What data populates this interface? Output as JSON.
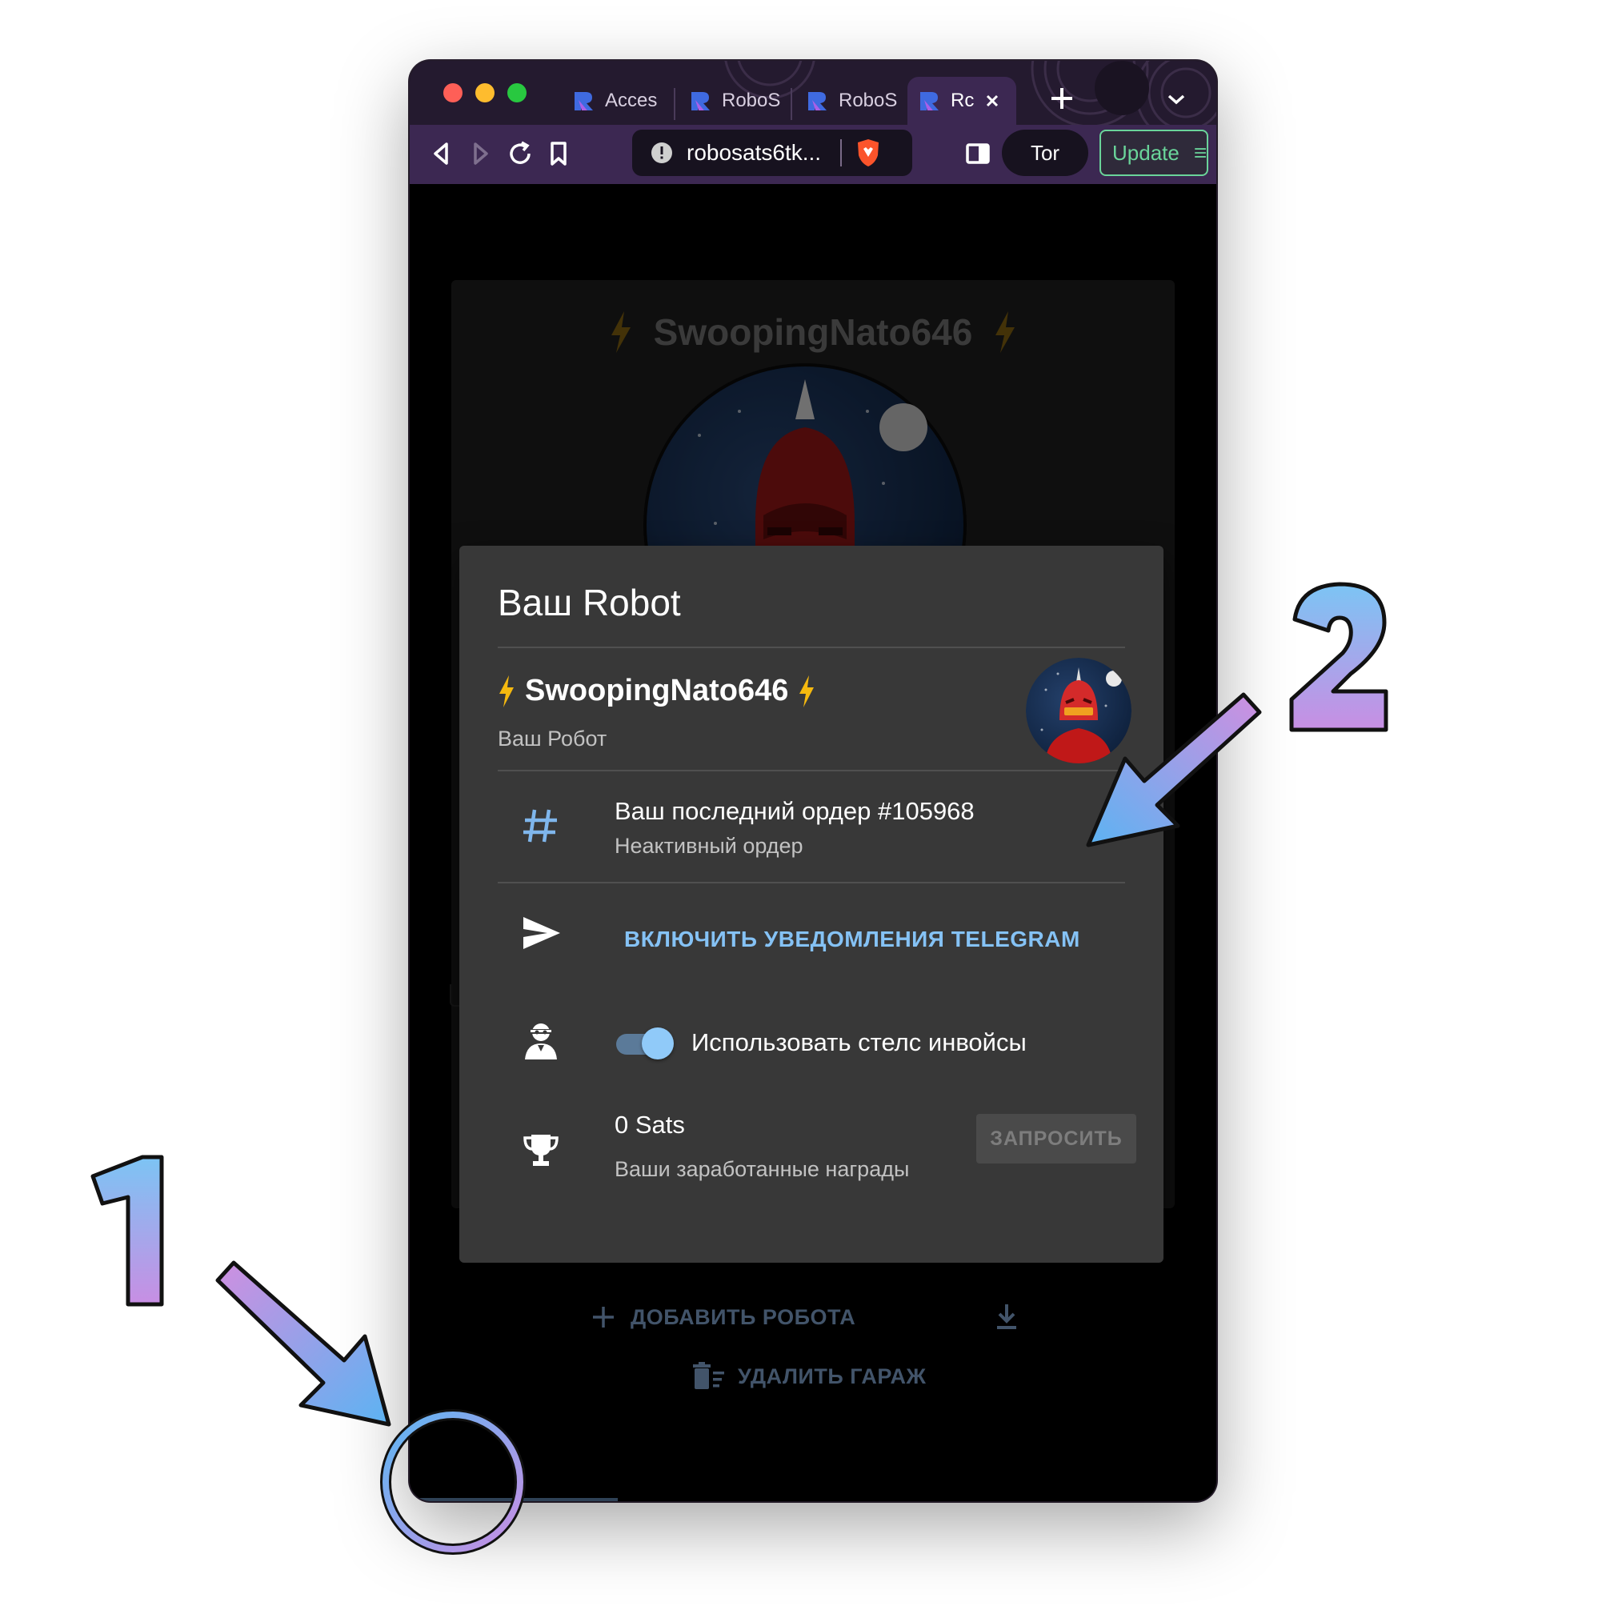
{
  "browser": {
    "tabs": [
      {
        "label": "Acces"
      },
      {
        "label": "RoboS"
      },
      {
        "label": "RoboS"
      },
      {
        "label": "Rc",
        "active": true
      }
    ],
    "url": "robosats6tk...",
    "tor_label": "Tor",
    "update_label": "Update"
  },
  "garage": {
    "robot_name": "SwoopingNato646",
    "add_robot_label": "ДОБАВИТЬ РОБОТА",
    "delete_garage_label": "УДАЛИТЬ ГАРАЖ"
  },
  "modal": {
    "title": "Ваш Robot",
    "nickname": "SwoopingNato646",
    "nickname_sub": "Ваш Робот",
    "last_order": {
      "primary": "Ваш последний ордер #105968",
      "secondary": "Неактивный ордер"
    },
    "telegram_label": "ВКЛЮЧИТЬ УВЕДОМЛЕНИЯ TELEGRAM",
    "stealth": {
      "label": "Использовать стелс инвойсы",
      "enabled": true
    },
    "rewards": {
      "amount": "0 Sats",
      "secondary": "Ваши заработанные награды",
      "claim_label": "ЗАПРОСИТЬ"
    }
  },
  "annotations": {
    "marker_1": "1",
    "marker_2": "2"
  },
  "colors": {
    "accent_link": "#85c2f5",
    "toggle_thumb": "#90caf9",
    "bolt": "#f5b90f",
    "update_green": "#6ad49a",
    "annotation_gradient": [
      "#5eb6f2",
      "#c88ee3"
    ]
  },
  "icons": {
    "order": "hash-icon",
    "telegram": "send-icon",
    "stealth": "incognito-user-icon",
    "rewards": "trophy-icon",
    "nav": [
      "robot-avatar",
      "robot-icon",
      "market-icon",
      "add-icon",
      "order-clipboard-icon",
      "settings-gear-icon",
      "more-icon"
    ]
  }
}
